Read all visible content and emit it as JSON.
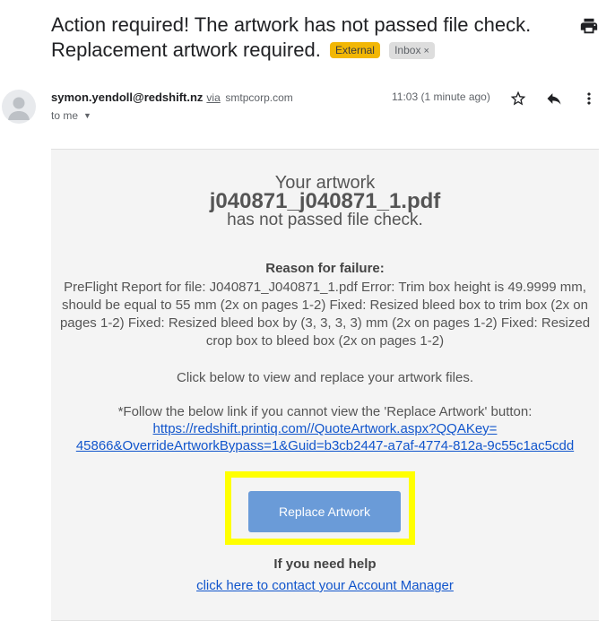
{
  "subject": {
    "line1": "Action required! The artwork has not passed file check.",
    "line2": "Replacement artwork required.",
    "external_label": "External",
    "inbox_label": "Inbox",
    "inbox_remove": "×"
  },
  "header": {
    "sender_email": "symon.yendoll@redshift.nz",
    "via_label": "via",
    "relay_domain": "smtpcorp.com",
    "recipient": "to me",
    "timestamp": "11:03 (1 minute ago)"
  },
  "icons": {
    "print": "print-icon",
    "star": "star-icon",
    "reply": "reply-icon",
    "more": "more-vert-icon",
    "avatar": "default-avatar-icon"
  },
  "body": {
    "your_artwork": "Your artwork",
    "filename": "j040871_j040871_1.pdf",
    "not_passed": "has not passed file check.",
    "reason_heading": "Reason for failure:",
    "reason_text": "PreFlight Report for file: J040871_J040871_1.pdf Error: Trim box height is 49.9999 mm, should be equal to 55 mm (2x on pages 1-2) Fixed: Resized bleed box to trim box (2x on pages 1-2) Fixed: Resized bleed box by (3, 3, 3, 3) mm (2x on pages 1-2) Fixed: Resized crop box to bleed box (2x on pages 1-2)",
    "click_below": "Click below to view and replace your artwork files.",
    "follow_text": "*Follow the below link if you cannot view the 'Replace Artwork' button:",
    "follow_link_line1": "https://redshift.printiq.com//QuoteArtwork.aspx?QQAKey=",
    "follow_link_line2": "45866&OverrideArtworkBypass=1&Guid=b3cb2447-a7af-4774-812a-9c55c1ac5cdd",
    "replace_button": "Replace Artwork",
    "help_heading": "If you need help",
    "contact_link": "click here to contact your Account Manager"
  },
  "colors": {
    "external_badge": "#f2b705",
    "button": "#6a9bd8",
    "highlight": "#ffff00",
    "link": "#1155cc",
    "body_bg": "#f4f4f4"
  }
}
